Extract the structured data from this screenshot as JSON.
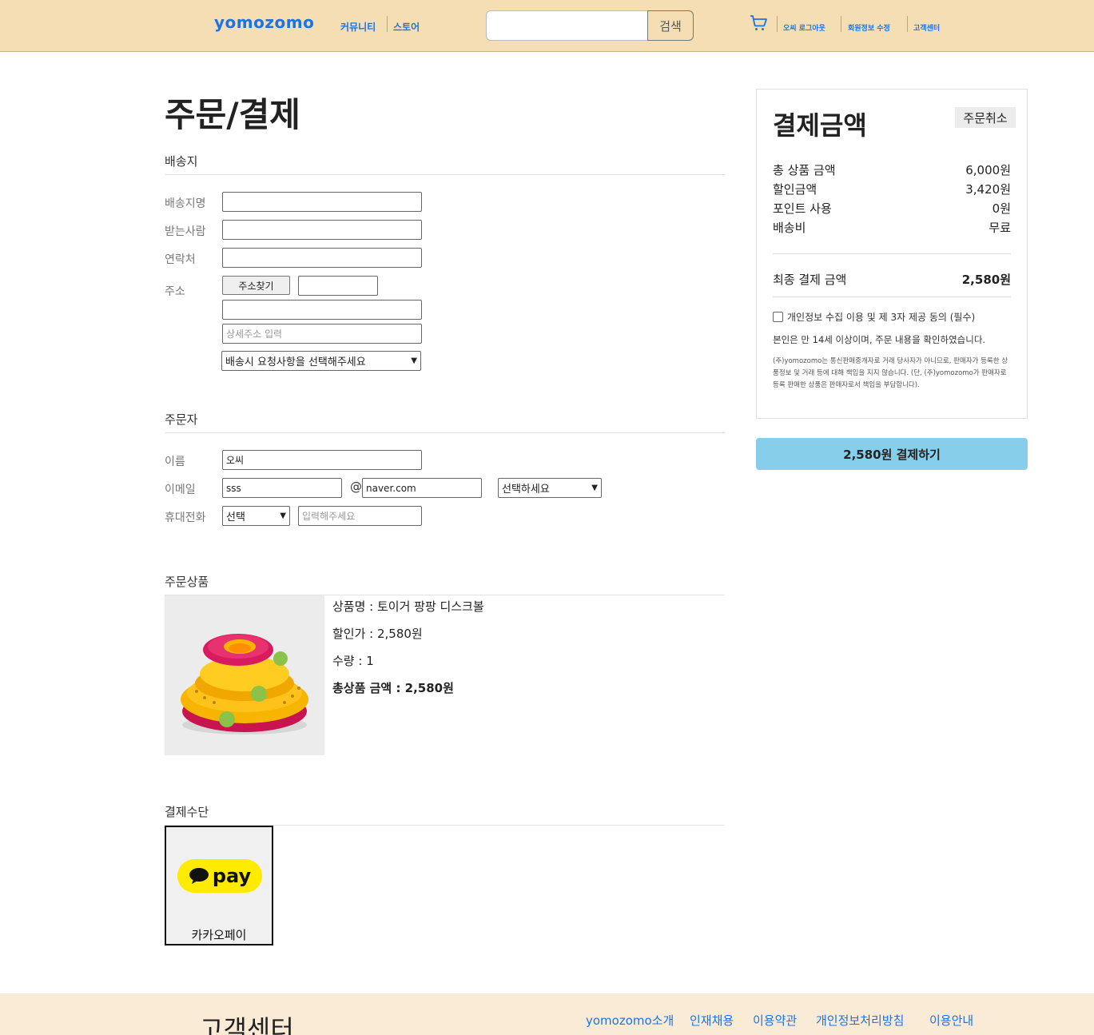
{
  "header": {
    "logo": "yomozomo",
    "nav": [
      "커뮤니티",
      "스토어"
    ],
    "search_placeholder": "",
    "search_button": "검색",
    "cart_icon": "cart-icon",
    "links": [
      "오씨 로그아웃",
      "회원정보 수정",
      "고객센터"
    ]
  },
  "page_title": "주문/결제",
  "shipping": {
    "title": "배송지",
    "labels": [
      "배송지명",
      "받는사람",
      "연락처",
      "주소"
    ],
    "address_button": "주소찾기",
    "detail_placeholder": "상세주소 입력",
    "request_select": "배송시 요청사항을 선택해주세요"
  },
  "orderer": {
    "title": "주문자",
    "labels": [
      "이름",
      "이메일",
      "휴대전화"
    ],
    "name_value": "오씨",
    "email_id": "sss",
    "email_domain": "naver.com",
    "email_select": "선택하세요",
    "phone_select": "선택",
    "phone_placeholder": "입력해주세요"
  },
  "product": {
    "title": "주문상품",
    "name": "상품명 : 토이거 팡팡 디스크볼",
    "price": "할인가 : 2,580원",
    "quantity": "수량 : 1",
    "total": "총상품 금액 : 2,580원"
  },
  "payment_method": {
    "title": "결제수단",
    "badge": "pay",
    "label": "카카오페이",
    "badge_color": "#ffeb00"
  },
  "summary": {
    "title": "결제금액",
    "cancel": "주문취소",
    "rows": [
      {
        "label": "총 상품 금액",
        "value": "6,000원"
      },
      {
        "label": "할인금액",
        "value": "3,420원"
      },
      {
        "label": "포인트 사용",
        "value": "0원"
      },
      {
        "label": "배송비",
        "value": "무료"
      }
    ],
    "final_label": "최종 결제 금액",
    "final_value": "2,580원",
    "agree": "개인정보 수집 이용 및 제 3자 제공 동의 (필수)",
    "confirm": "본인은 만 14세 이상이며, 주문 내용을 확인하였습니다.",
    "notice": "(주)yomozomo는 통신판매중개자로 거래 당사자가 아니므로, 판매자가 등록한 상품정보 및 거래 등에 대해 책임을 지지 않습니다. (단, (주)yomozomo가 판매자로 등록 판매한 상품은 판매자로서 책임을 부담합니다)."
  },
  "pay_button": "2,580원 결제하기",
  "footer": {
    "title": "고객센터",
    "links": [
      "yomozomo소개",
      "인재채용",
      "이용약관",
      "개인정보처리방침",
      "이용안내"
    ]
  },
  "colors": {
    "header_bg": "#f5deb3",
    "link": "#1a73e8",
    "pay_button": "#87ceeb",
    "footer_bg": "#faebd7"
  }
}
